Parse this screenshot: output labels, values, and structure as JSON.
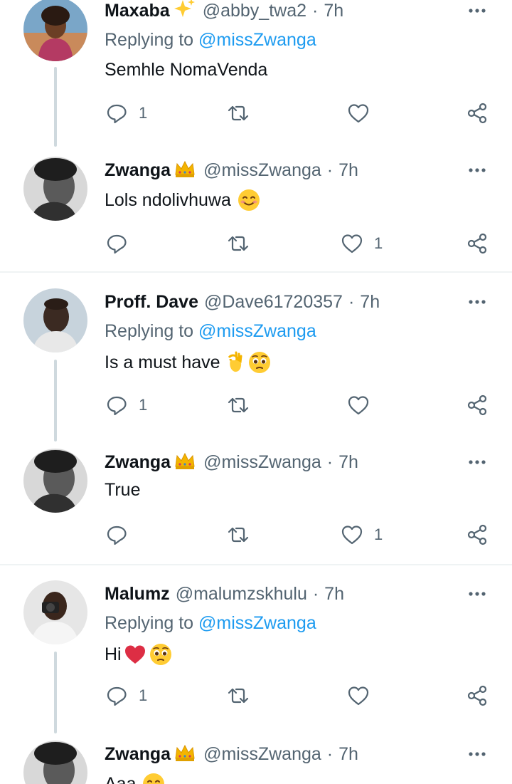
{
  "tweets": [
    {
      "name": "Maxaba",
      "badge": "sparkles-icon",
      "handle": "@abby_twa2",
      "separator": "·",
      "time": "7h",
      "replying_prefix": "Replying to",
      "replying_to": "@missZwanga",
      "text": "Semhle NomaVenda",
      "reply_count": "1",
      "like_count": ""
    },
    {
      "name": "Zwanga",
      "badge": "crown-icon",
      "handle": "@missZwanga",
      "separator": "·",
      "time": "7h",
      "text": "Lols ndolivhuwa",
      "emoji": [
        "smiling-face-icon"
      ],
      "reply_count": "",
      "like_count": "1"
    },
    {
      "name": "Proff. Dave",
      "handle": "@Dave61720357",
      "separator": "·",
      "time": "7h",
      "replying_prefix": "Replying to",
      "replying_to": "@missZwanga",
      "text": "Is a must have",
      "emoji": [
        "ok-hand-icon",
        "pleading-face-icon"
      ],
      "reply_count": "1",
      "like_count": ""
    },
    {
      "name": "Zwanga",
      "badge": "crown-icon",
      "handle": "@missZwanga",
      "separator": "·",
      "time": "7h",
      "text": "True",
      "reply_count": "",
      "like_count": "1"
    },
    {
      "name": "Malumz",
      "handle": "@malumzskhulu",
      "separator": "·",
      "time": "7h",
      "replying_prefix": "Replying to",
      "replying_to": "@missZwanga",
      "text": "Hi",
      "emoji": [
        "red-heart-icon",
        "pleading-face-icon"
      ],
      "reply_count": "1",
      "like_count": ""
    },
    {
      "name": "Zwanga",
      "badge": "crown-icon",
      "handle": "@missZwanga",
      "separator": "·",
      "time": "7h",
      "text": "Aaa",
      "emoji": [
        "smiling-face-icon"
      ],
      "reply_count": "",
      "like_count": ""
    }
  ],
  "colors": {
    "accent": "#1d9bf0",
    "secondary_text": "#536471",
    "thread_line": "#cfd9de",
    "divider": "#eff3f4"
  }
}
